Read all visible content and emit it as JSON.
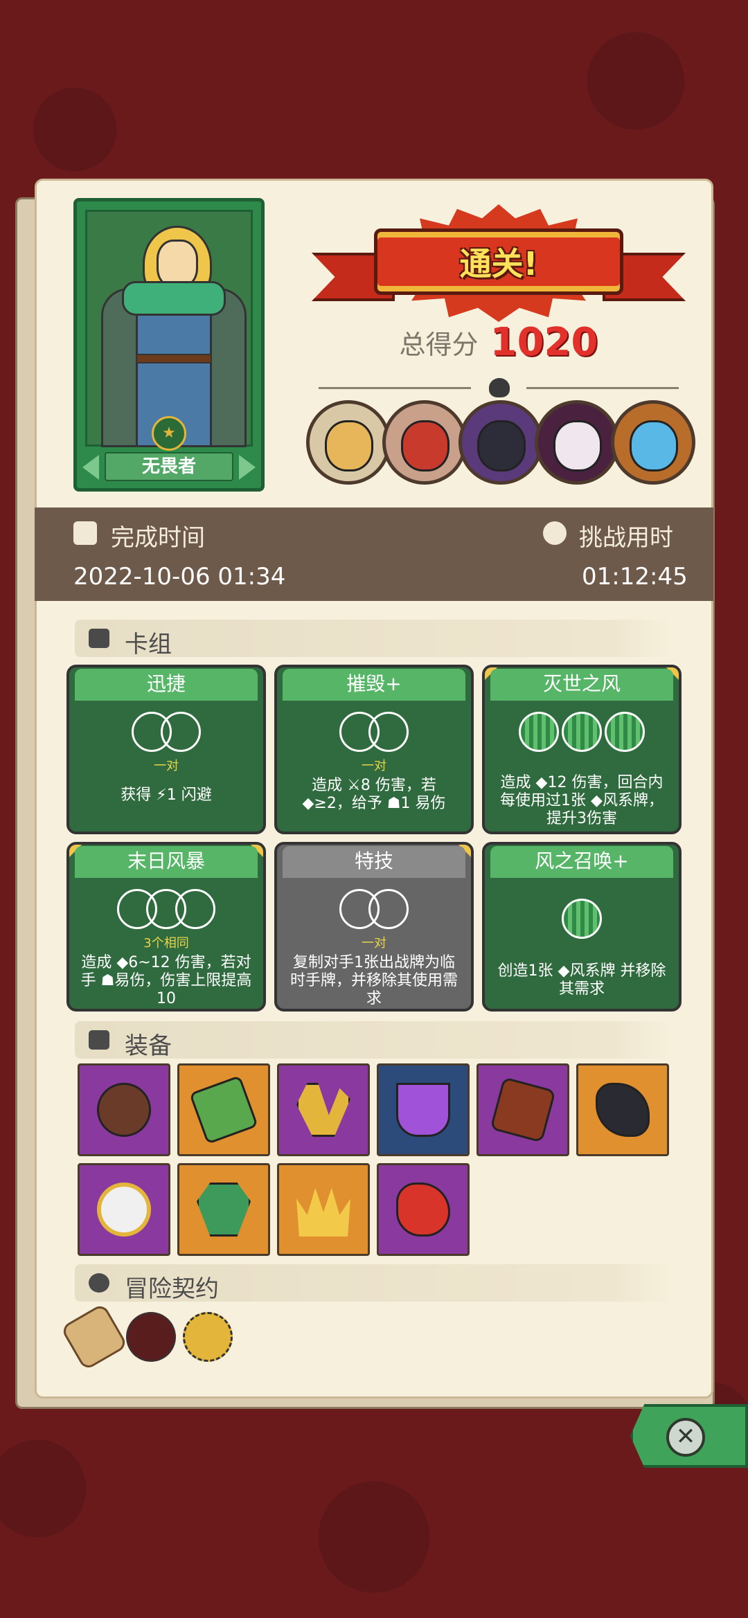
{
  "hero": {
    "name": "无畏者"
  },
  "result": {
    "banner": "通关!",
    "score_label": "总得分",
    "score_value": "1020"
  },
  "times": {
    "finish_label": "完成时间",
    "finish_value": "2022-10-06 01:34",
    "challenge_label": "挑战用时",
    "challenge_value": "01:12:45"
  },
  "deck": {
    "title": "卡组",
    "cards": [
      {
        "name": "迅捷",
        "slot_label": "一对",
        "desc": "获得 ⚡1 闪避"
      },
      {
        "name": "摧毁+",
        "slot_label": "一对",
        "desc": "造成 ⚔8 伤害，若 ◆≥2，给予 ☗1 易伤"
      },
      {
        "name": "灭世之风",
        "slot_label": "",
        "desc": "造成 ◆12 伤害，回合内每使用过1张 ◆风系牌，提升3伤害"
      },
      {
        "name": "末日风暴",
        "slot_label": "3个相同",
        "desc": "造成 ◆6~12 伤害，若对手 ☗易伤，伤害上限提高10"
      },
      {
        "name": "特技",
        "slot_label": "一对",
        "desc": "复制对手1张出战牌为临时手牌，并移除其使用需求"
      },
      {
        "name": "风之召唤+",
        "slot_label": "",
        "desc": "创造1张 ◆风系牌 并移除其需求"
      }
    ]
  },
  "equipment": {
    "title": "装备",
    "items": [
      {
        "icon": "button-icon",
        "color": "#8a3a9e"
      },
      {
        "icon": "green-stone-icon",
        "color": "#e0902e"
      },
      {
        "icon": "claw-icon",
        "color": "#8a3a9e"
      },
      {
        "icon": "potion-icon",
        "color": "#2d4b7a"
      },
      {
        "icon": "shield-icon",
        "color": "#8a3a9e"
      },
      {
        "icon": "glove-icon",
        "color": "#e0902e"
      },
      {
        "icon": "mirror-icon",
        "color": "#8a3a9e"
      },
      {
        "icon": "gem-icon",
        "color": "#e0902e"
      },
      {
        "icon": "crown-icon",
        "color": "#e0902e"
      },
      {
        "icon": "red-flask-icon",
        "color": "#8a3a9e"
      }
    ]
  },
  "contracts": {
    "title": "冒险契约",
    "items": [
      {
        "icon": "scroll-icon"
      },
      {
        "icon": "pouch-icon"
      },
      {
        "icon": "coin-icon"
      }
    ]
  },
  "close": {
    "symbol": "✕"
  }
}
